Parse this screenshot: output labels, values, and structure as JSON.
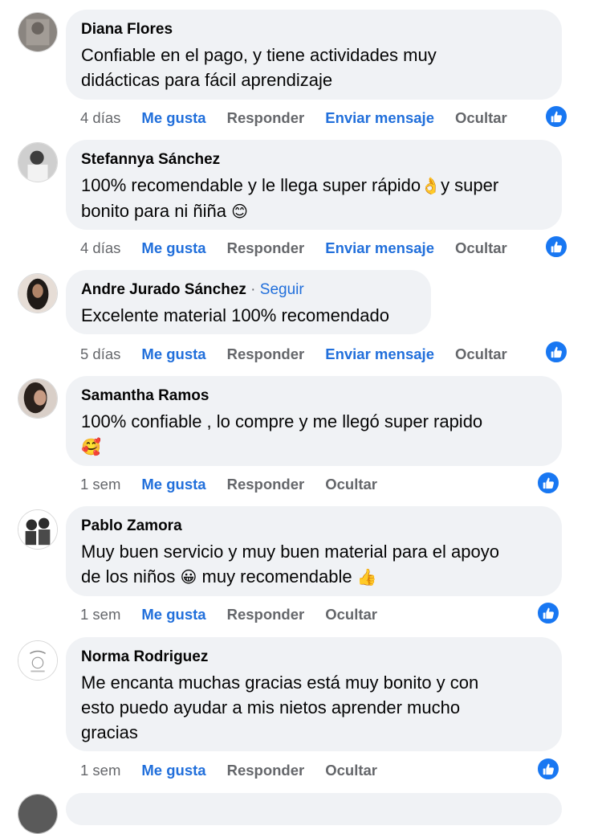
{
  "comments": [
    {
      "author": "Diana Flores",
      "text_lines": [
        "Confiable en el pago, y tiene actividades muy",
        "didácticas para fácil aprendizaje"
      ],
      "time": "4 días",
      "like": "Me gusta",
      "reply": "Responder",
      "message": "Enviar mensaje",
      "hide": "Ocultar"
    },
    {
      "author": "Stefannya Sánchez",
      "text_lines": [
        "100% recomendable y le llega super rápido",
        "y super",
        "bonito para ni ñiña "
      ],
      "emojis": [
        "👌",
        "😊"
      ],
      "time": "4 días",
      "like": "Me gusta",
      "reply": "Responder",
      "message": "Enviar mensaje",
      "hide": "Ocultar"
    },
    {
      "author": "Andre Jurado Sánchez",
      "separator": " · ",
      "follow": "Seguir",
      "text_lines": [
        "Excelente material 100% recomendado"
      ],
      "time": "5 días",
      "like": "Me gusta",
      "reply": "Responder",
      "message": "Enviar mensaje",
      "hide": "Ocultar"
    },
    {
      "author": "Samantha Ramos",
      "text_lines": [
        "100% confiable , lo compre y me llegó super rapido"
      ],
      "emojis": [
        "🥰"
      ],
      "time": "1 sem",
      "like": "Me gusta",
      "reply": "Responder",
      "hide": "Ocultar"
    },
    {
      "author": "Pablo Zamora",
      "text_lines": [
        "Muy buen servicio y muy buen material para el apoyo",
        "de los niños ",
        " muy recomendable "
      ],
      "emojis": [
        "😀",
        "👍"
      ],
      "time": "1 sem",
      "like": "Me gusta",
      "reply": "Responder",
      "hide": "Ocultar"
    },
    {
      "author": "Norma Rodriguez",
      "text_lines": [
        "Me encanta muchas gracias está muy bonito y con",
        "esto puedo ayudar a mis nietos aprender mucho",
        "gracias"
      ],
      "time": "1 sem",
      "like": "Me gusta",
      "reply": "Responder",
      "hide": "Ocultar"
    }
  ],
  "colors": {
    "bubble": "#f0f2f5",
    "link_blue": "#216fdb",
    "meta_gray": "#65676b",
    "reaction_blue": "#1877f2"
  },
  "icons": {
    "reaction": "thumbs-up-icon"
  }
}
